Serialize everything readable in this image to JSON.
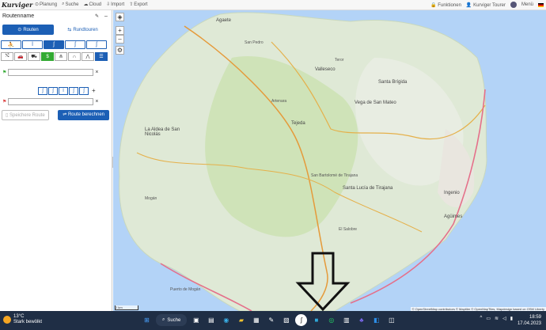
{
  "app": {
    "logo": "Kurviger",
    "nav": [
      {
        "label": "Planung",
        "icon": "target-icon"
      },
      {
        "label": "Suche",
        "icon": "search-icon"
      },
      {
        "label": "Cloud",
        "icon": "cloud-icon"
      },
      {
        "label": "Import",
        "icon": "import-icon"
      },
      {
        "label": "Export",
        "icon": "export-icon"
      }
    ],
    "right": {
      "functions": "Funktionen",
      "user": "Kurviger Tourer",
      "menu": "Menü"
    }
  },
  "panel": {
    "route_name": "Routenname",
    "tabs": {
      "routes": "Routen",
      "round": "Rundtouren"
    },
    "waypoint_start": {
      "value": "",
      "placeholder": ""
    },
    "waypoint_end": {
      "value": "",
      "placeholder": ""
    },
    "save_label": "Speichere Route",
    "calc_label": "Route berechnen"
  },
  "map": {
    "places": [
      {
        "name": "Agaete"
      },
      {
        "name": "San Pedro"
      },
      {
        "name": "Valleseco"
      },
      {
        "name": "Santa Brígida"
      },
      {
        "name": "Vega de San Mateo"
      },
      {
        "name": "Teror"
      },
      {
        "name": "Artenara"
      },
      {
        "name": "Tejeda"
      },
      {
        "name": "La Aldea de San Nicolás"
      },
      {
        "name": "Santa Lucía de Tirajana"
      },
      {
        "name": "San Bartolomé de Tirajana"
      },
      {
        "name": "Ingenio"
      },
      {
        "name": "Agüimes"
      },
      {
        "name": "Mogán"
      },
      {
        "name": "El Salobre"
      },
      {
        "name": "Puerto de Mogán"
      }
    ],
    "attribution": "© OpenStreetMap contributors © Maptiler © OpenMapTiles, Mapdesign based on OSM Liberty",
    "scale": "2 km"
  },
  "taskbar": {
    "temp": "13°C",
    "weather": "Stark bewölkt",
    "search": "Suche",
    "time": "18:59",
    "date": "17.04.2023"
  }
}
